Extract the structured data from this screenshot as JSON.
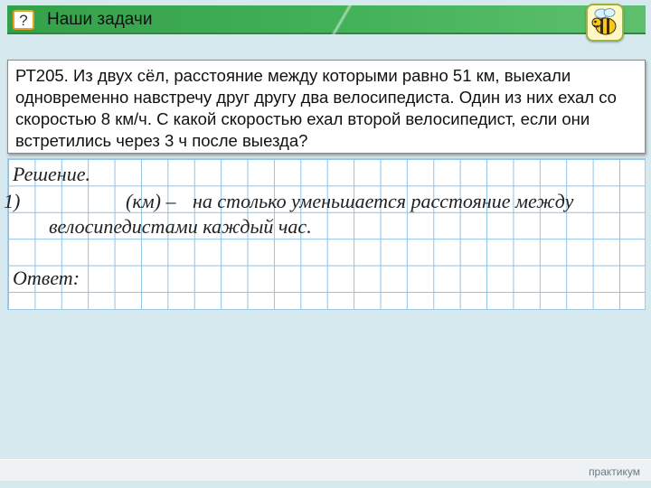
{
  "header": {
    "question_mark": "?",
    "title": "Наши задачи"
  },
  "task": {
    "text": "РТ205. Из двух сёл, расстояние между которыми равно 51 км, выехали одновременно навстречу друг другу два велосипедиста. Один из них ехал со скоростью 8 км/ч. С какой скоростью ехал второй велосипедист, если они встретились через 3 ч после выезда?"
  },
  "solution": {
    "heading": "Решение.",
    "step_number": "1)",
    "step_unit": "(км) –",
    "step_text_line1": "на столько уменьшается расстояние между",
    "step_text_line2": "велосипедистами каждый час.",
    "answer_label": "Ответ:"
  },
  "footer": {
    "label": "практикум"
  },
  "colors": {
    "header_green": "#43b259",
    "grid_line": "#8fc3e8",
    "background": "#d6e9ef"
  },
  "icons": {
    "header_left": "question-mark-icon",
    "header_right": "bee-icon"
  }
}
